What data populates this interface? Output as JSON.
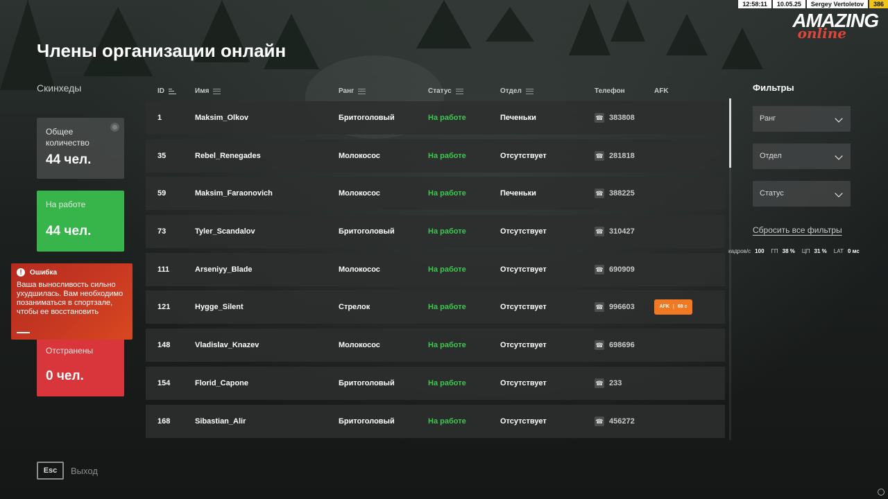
{
  "hud": {
    "time": "12:58:11",
    "date": "10.05.25",
    "player": "Sergey Vertoletov",
    "level": "386"
  },
  "logo": {
    "main": "AMAZING",
    "sub": "online"
  },
  "page_title": "Члены организации онлайн",
  "section_title": "Скинхеды",
  "stats": {
    "total": {
      "label": "Общее количество",
      "value": "44 чел."
    },
    "at_work": {
      "label": "На работе",
      "value": "44 чел."
    },
    "removed": {
      "label": "Отстранены",
      "value": "0 чел."
    }
  },
  "error": {
    "title": "Ошибка",
    "text": "Ваша выносливость сильно ухудшилась. Вам необходимо позаниматься в спортзале, чтобы ее восстановить"
  },
  "columns": {
    "id": "ID",
    "name": "Имя",
    "rank": "Ранг",
    "status": "Статус",
    "dept": "Отдел",
    "phone": "Телефон",
    "afk": "AFK"
  },
  "members": [
    {
      "id": "1",
      "name": "Maksim_Olkov",
      "rank": "Бритоголовый",
      "status": "На работе",
      "dept": "Печеньки",
      "phone": "383808",
      "afk": null
    },
    {
      "id": "35",
      "name": "Rebel_Renegades",
      "rank": "Молокосос",
      "status": "На работе",
      "dept": "Отсутствует",
      "phone": "281818",
      "afk": null
    },
    {
      "id": "59",
      "name": "Maksim_Faraonovich",
      "rank": "Молокосос",
      "status": "На работе",
      "dept": "Печеньки",
      "phone": "388225",
      "afk": null
    },
    {
      "id": "73",
      "name": "Tyler_Scandalov",
      "rank": "Бритоголовый",
      "status": "На работе",
      "dept": "Отсутствует",
      "phone": "310427",
      "afk": null
    },
    {
      "id": "111",
      "name": "Arseniyy_Blade",
      "rank": "Молокосос",
      "status": "На работе",
      "dept": "Отсутствует",
      "phone": "690909",
      "afk": null
    },
    {
      "id": "121",
      "name": "Hygge_Silent",
      "rank": "Стрелок",
      "status": "На работе",
      "dept": "Отсутствует",
      "phone": "996603",
      "afk": {
        "label": "AFK",
        "time": "68 с"
      }
    },
    {
      "id": "148",
      "name": "Vladislav_Knazev",
      "rank": "Молокосос",
      "status": "На работе",
      "dept": "Отсутствует",
      "phone": "698696",
      "afk": null
    },
    {
      "id": "154",
      "name": "Florid_Capone",
      "rank": "Бритоголовый",
      "status": "На работе",
      "dept": "Отсутствует",
      "phone": "233",
      "afk": null
    },
    {
      "id": "168",
      "name": "Sibastian_Alir",
      "rank": "Бритоголовый",
      "status": "На работе",
      "dept": "Отсутствует",
      "phone": "456272",
      "afk": null
    }
  ],
  "filters": {
    "title": "Фильтры",
    "rank": "Ранг",
    "dept": "Отдел",
    "status": "Статус",
    "reset": "Сбросить все фильтры"
  },
  "perf": {
    "fps_label": "кадров/с",
    "fps": "100",
    "gpu_label": "ГП",
    "gpu": "38 %",
    "cpu_label": "ЦП",
    "cpu": "31 %",
    "lat_label": "LAT",
    "lat": "0 мс"
  },
  "footer": {
    "esc": "Esc",
    "exit": "Выход"
  }
}
